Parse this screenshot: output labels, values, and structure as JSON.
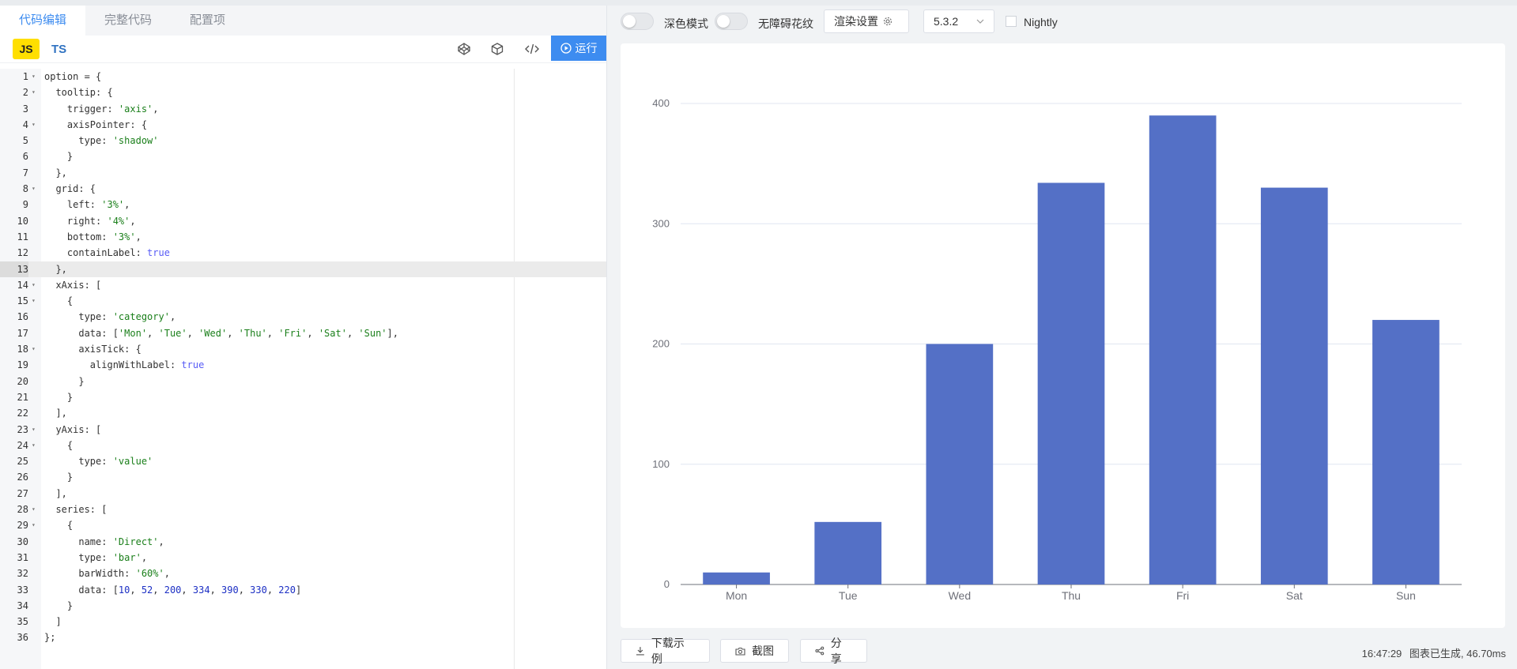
{
  "tabs": [
    "代码编辑",
    "完整代码",
    "配置项"
  ],
  "toolbar": {
    "js_label": "JS",
    "ts_label": "TS",
    "run_label": "运行"
  },
  "code_lines": [
    "option = {",
    "  tooltip: {",
    "    trigger: 'axis',",
    "    axisPointer: {",
    "      type: 'shadow'",
    "    }",
    "  },",
    "  grid: {",
    "    left: '3%',",
    "    right: '4%',",
    "    bottom: '3%',",
    "    containLabel: true",
    "  },",
    "  xAxis: [",
    "    {",
    "      type: 'category',",
    "      data: ['Mon', 'Tue', 'Wed', 'Thu', 'Fri', 'Sat', 'Sun'],",
    "      axisTick: {",
    "        alignWithLabel: true",
    "      }",
    "    }",
    "  ],",
    "  yAxis: [",
    "    {",
    "      type: 'value'",
    "    }",
    "  ],",
    "  series: [",
    "    {",
    "      name: 'Direct',",
    "      type: 'bar',",
    "      barWidth: '60%',",
    "      data: [10, 52, 200, 334, 390, 330, 220]",
    "    }",
    "  ]",
    "};"
  ],
  "active_line": 13,
  "right_toolbar": {
    "dark_mode_label": "深色模式",
    "aria_label": "无障碍花纹",
    "render_settings_label": "渲染设置",
    "version_value": "5.3.2",
    "nightly_label": "Nightly"
  },
  "footer": {
    "download_label": "下载示例",
    "screenshot_label": "截图",
    "share_label": "分享",
    "status_time": "16:47:29",
    "status_text": "图表已生成, 46.70ms"
  },
  "colors": {
    "accent": "#3d8cf0",
    "bar": "#5470c6",
    "js_badge": "#ffdf00"
  },
  "chart_data": {
    "type": "bar",
    "categories": [
      "Mon",
      "Tue",
      "Wed",
      "Thu",
      "Fri",
      "Sat",
      "Sun"
    ],
    "series": [
      {
        "values": [
          10,
          52,
          200,
          334,
          390,
          330,
          220
        ]
      }
    ],
    "ylim": [
      0,
      400
    ],
    "yticks": [
      0,
      100,
      200,
      300,
      400
    ],
    "grid": true,
    "title": "",
    "xlabel": "",
    "ylabel": ""
  }
}
